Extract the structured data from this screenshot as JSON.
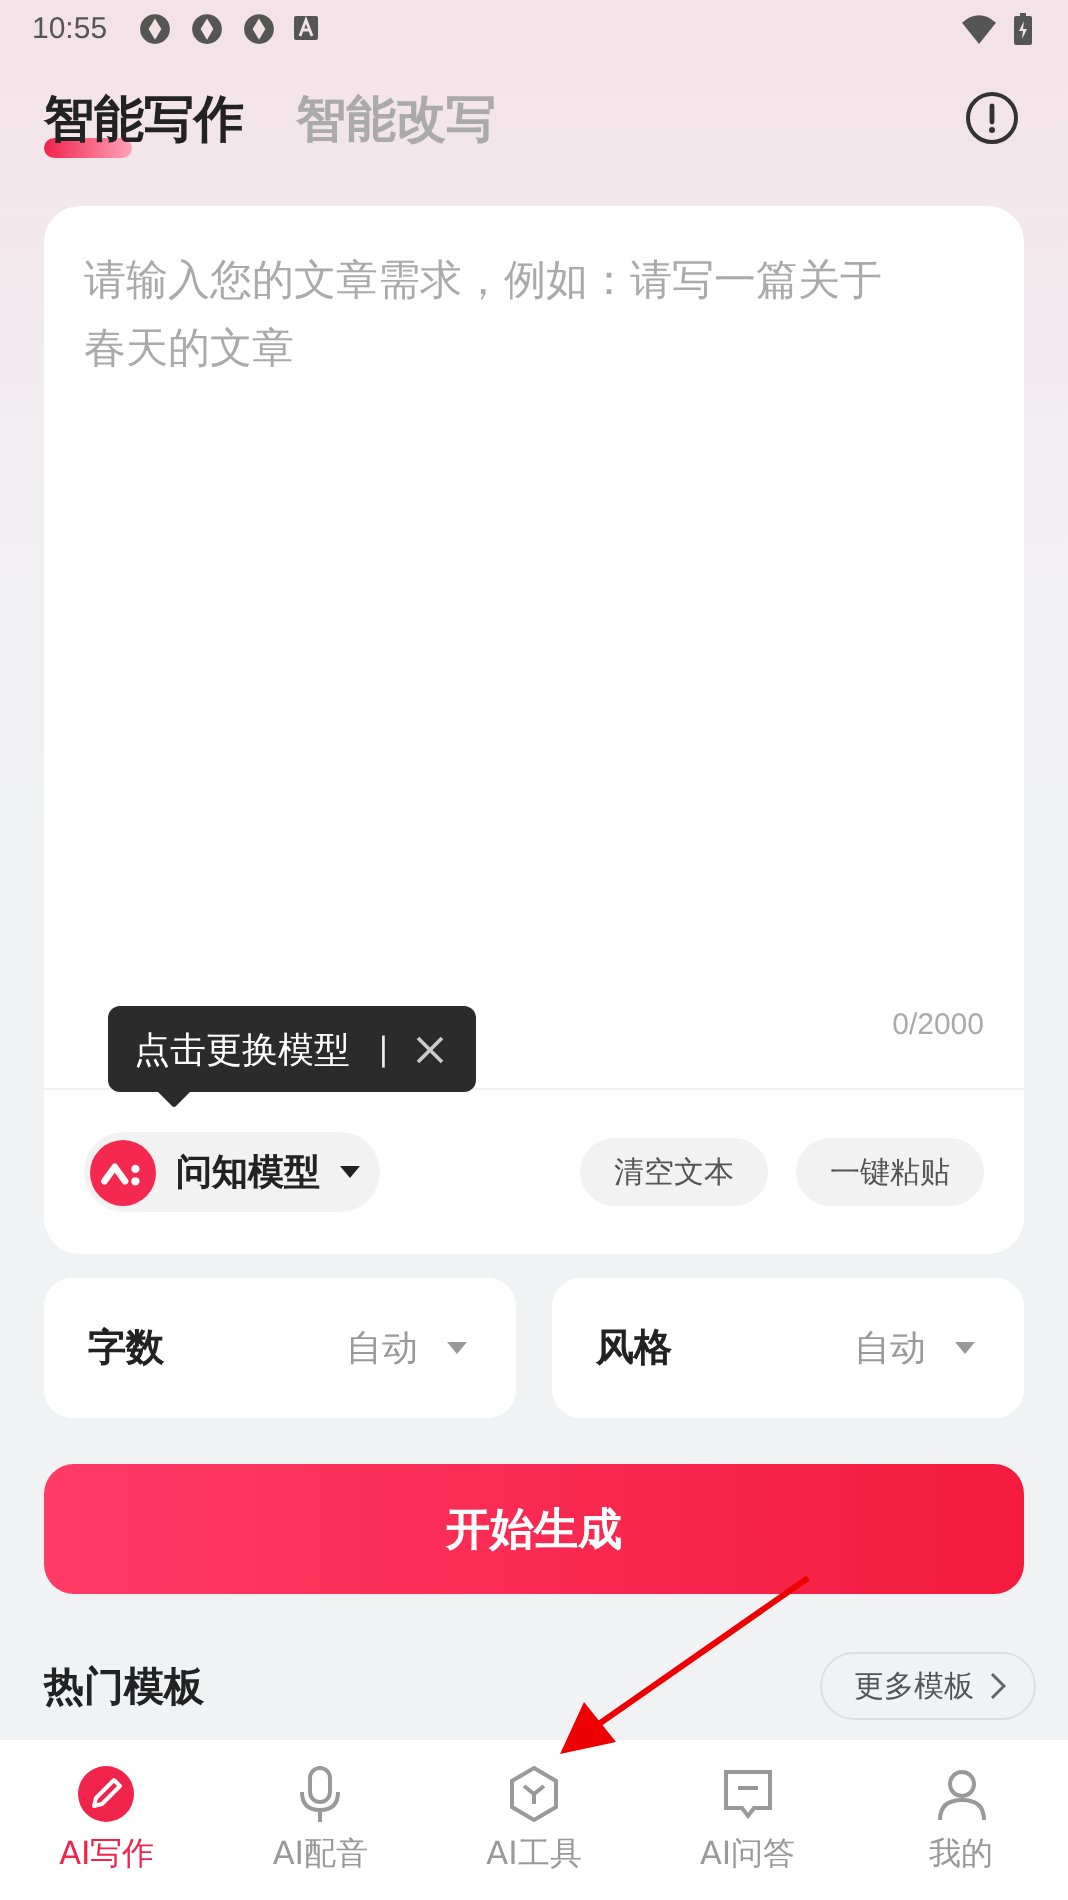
{
  "status_bar": {
    "time": "10:55"
  },
  "tabs": [
    {
      "label": "智能写作",
      "selected": true
    },
    {
      "label": "智能改写",
      "selected": false
    }
  ],
  "editor": {
    "placeholder": "请输入您的文章需求，例如：请写一篇关于春天的文章",
    "counter": "0/2000"
  },
  "tooltip": {
    "text": "点击更换模型",
    "separator": "|"
  },
  "model": {
    "label": "问知模型"
  },
  "actions": [
    "清空文本",
    "一键粘贴"
  ],
  "options": [
    {
      "label": "字数",
      "value": "自动"
    },
    {
      "label": "风格",
      "value": "自动"
    }
  ],
  "generate_button": "开始生成",
  "section": {
    "title": "热门模板",
    "more": "更多模板"
  },
  "nav": [
    {
      "label": "AI写作",
      "kind": "pen",
      "selected": true
    },
    {
      "label": "AI配音",
      "kind": "mic",
      "selected": false
    },
    {
      "label": "AI工具",
      "kind": "cube",
      "selected": false
    },
    {
      "label": "AI问答",
      "kind": "chat",
      "selected": false
    },
    {
      "label": "我的",
      "kind": "user",
      "selected": false
    }
  ]
}
